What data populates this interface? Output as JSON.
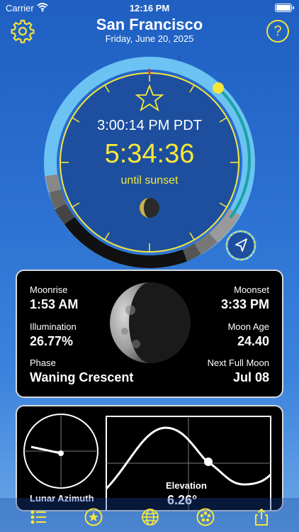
{
  "status_bar": {
    "carrier": "Carrier",
    "time": "12:16 PM"
  },
  "header": {
    "city": "San Francisco",
    "date": "Friday, June 20, 2025",
    "help_label": "?"
  },
  "dial": {
    "clock_time": "3:00:14 PM PDT",
    "countdown": "5:34:36",
    "caption": "until sunset"
  },
  "moon": {
    "moonrise_label": "Moonrise",
    "moonrise": "1:53 AM",
    "moonset_label": "Moonset",
    "moonset": "3:33 PM",
    "illumination_label": "Illumination",
    "illumination": "26.77%",
    "age_label": "Moon Age",
    "age": "24.40",
    "phase_label": "Phase",
    "phase": "Waning Crescent",
    "next_full_label": "Next Full Moon",
    "next_full": "Jul 08"
  },
  "chart": {
    "azimuth_label": "Lunar Azimuth",
    "elevation_label": "Elevation",
    "elevation_value": "6.26°"
  },
  "colors": {
    "accent_yellow": "#f6e63b",
    "ring_light_blue": "#6cc3f3",
    "teal": "#1aa3a3"
  },
  "tabs": [
    {
      "icon": "list-icon"
    },
    {
      "icon": "star-icon"
    },
    {
      "icon": "globe-icon"
    },
    {
      "icon": "moon-phases-icon"
    },
    {
      "icon": "share-icon"
    }
  ]
}
